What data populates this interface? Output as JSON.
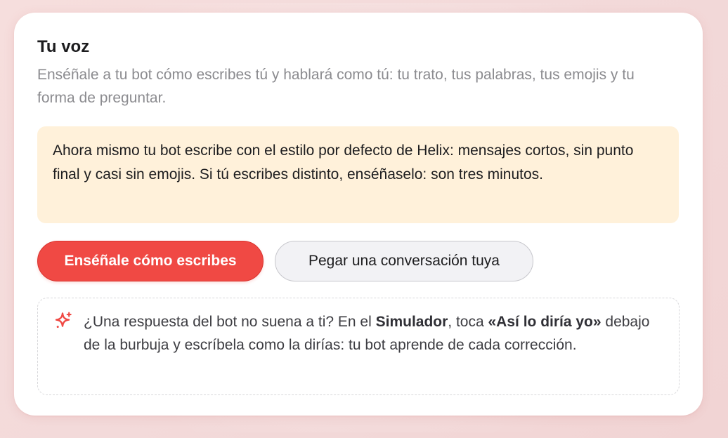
{
  "colors": {
    "accent": "#f04944",
    "notice_background": "#fff1da",
    "secondary_button_background": "#f2f2f5",
    "text_primary": "#1d1d1f",
    "text_secondary": "#8b8b8f"
  },
  "section": {
    "title": "Tu voz",
    "subtitle": "Enséñale a tu bot cómo escribes tú y hablará como tú: tu trato, tus palabras, tus emojis y tu forma de preguntar."
  },
  "notice": {
    "text": "Ahora mismo tu bot escribe con el estilo por defecto de Helix: mensajes cortos, sin punto final y casi sin emojis. Si tú escribes distinto, enséñaselo: son tres minutos."
  },
  "actions": {
    "primary_label": "Enséñale cómo escribes",
    "secondary_label": "Pegar una conversación tuya"
  },
  "tip": {
    "icon": "sparkle-icon",
    "prefix": "¿Una respuesta del bot no suena a ti? En el ",
    "simulator": "Simulador",
    "middle": ", toca ",
    "phrase": "«Así lo diría yo»",
    "suffix": " debajo de la burbuja y escríbela como la dirías: tu bot aprende de cada corrección."
  }
}
